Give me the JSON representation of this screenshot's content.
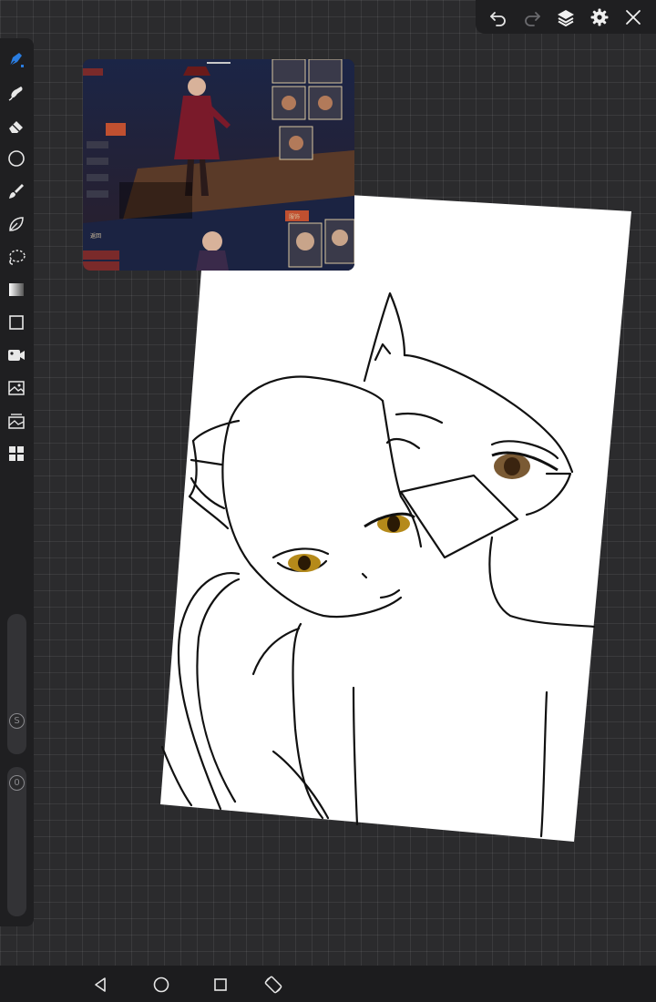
{
  "app": {
    "accent_color": "#2a7de1",
    "canvas_color": "#ffffff",
    "toolbar_color": "#1f1f21"
  },
  "top_toolbar": {
    "undo_icon": "undo-arrow",
    "redo_icon": "redo-arrow",
    "layers_icon": "layers-stack",
    "settings_icon": "gear",
    "close_icon": "x-mark"
  },
  "left_toolbar": {
    "tools": [
      {
        "name": "pen",
        "icon": "pen-nib",
        "active": true
      },
      {
        "name": "smudge",
        "icon": "finger-smudge"
      },
      {
        "name": "eraser",
        "icon": "eraser"
      },
      {
        "name": "shape",
        "icon": "circle"
      },
      {
        "name": "brush",
        "icon": "paintbrush"
      },
      {
        "name": "leaf-brush",
        "icon": "leaf"
      },
      {
        "name": "lasso",
        "icon": "dashed-lasso"
      },
      {
        "name": "gradient",
        "icon": "gradient-square"
      },
      {
        "name": "rectangle",
        "icon": "square-outline"
      },
      {
        "name": "video",
        "icon": "camera"
      },
      {
        "name": "image",
        "icon": "image-frame"
      },
      {
        "name": "gallery",
        "icon": "gallery-stack"
      },
      {
        "name": "more",
        "icon": "four-grid"
      }
    ],
    "size_slider_label": "S",
    "opacity_slider_label": "0"
  },
  "reference_image": {
    "label_1": "服饰",
    "label_2": "返回"
  },
  "nav_bar": {
    "back_icon": "triangle-back",
    "home_icon": "circle-home",
    "recents_icon": "square-recents",
    "rotate_icon": "rotate-screen"
  }
}
